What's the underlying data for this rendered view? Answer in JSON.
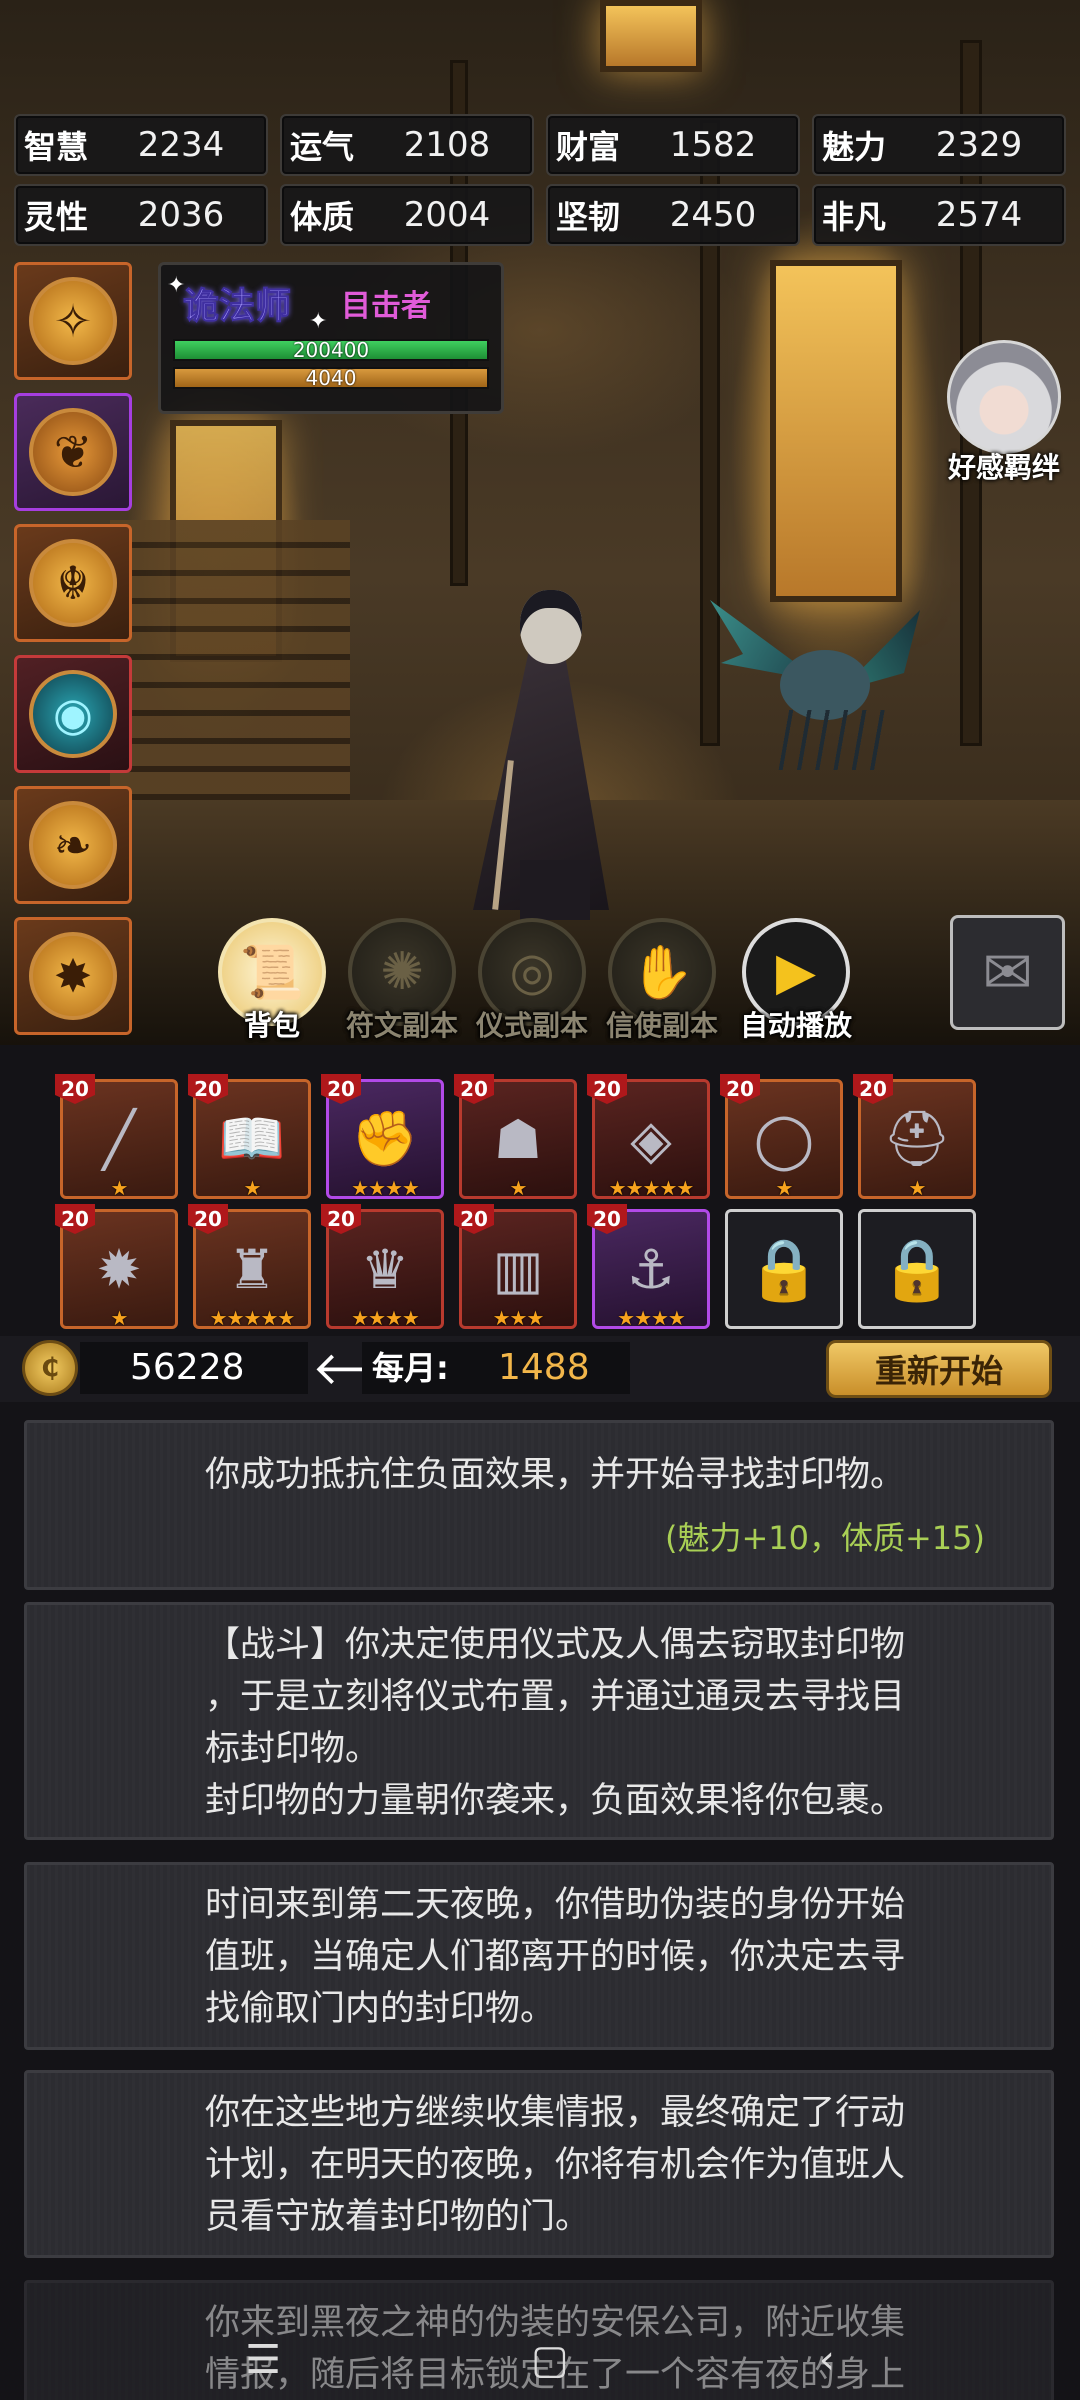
{
  "stats": [
    {
      "label": "智慧",
      "value": "2234"
    },
    {
      "label": "运气",
      "value": "2108"
    },
    {
      "label": "财富",
      "value": "1582"
    },
    {
      "label": "魅力",
      "value": "2329"
    },
    {
      "label": "灵性",
      "value": "2036"
    },
    {
      "label": "体质",
      "value": "2004"
    },
    {
      "label": "坚韧",
      "value": "2450"
    },
    {
      "label": "非凡",
      "value": "2574"
    }
  ],
  "character": {
    "job": "诡法师",
    "title": "目击者",
    "hp_text": "200400",
    "mp_text": "4040",
    "hp_fraction": 1.0,
    "mp_fraction": 1.0
  },
  "skills": [
    {
      "icon": "compass-icon",
      "color": "orange"
    },
    {
      "icon": "tree-icon",
      "color": "purple"
    },
    {
      "icon": "flame-sigil-icon",
      "color": "orange"
    },
    {
      "icon": "eye-orb-icon",
      "color": "red"
    },
    {
      "icon": "leaf-icon",
      "color": "orange"
    },
    {
      "icon": "star-rose-icon",
      "color": "orange"
    }
  ],
  "affinity": {
    "label": "好感羁绊"
  },
  "actions": [
    {
      "label": "背包",
      "icon": "scroll-icon",
      "enabled": true
    },
    {
      "label": "符文副本",
      "icon": "rune-icon",
      "enabled": false
    },
    {
      "label": "仪式副本",
      "icon": "eye-icon",
      "enabled": false
    },
    {
      "label": "信使副本",
      "icon": "hand-icon",
      "enabled": false
    },
    {
      "label": "自动播放",
      "icon": "play-icon",
      "enabled": true
    }
  ],
  "inventory": [
    {
      "level": "20",
      "icon": "staff-icon",
      "rarity": "orange",
      "stars": "★"
    },
    {
      "level": "20",
      "icon": "book-icon",
      "rarity": "orange",
      "stars": "★"
    },
    {
      "level": "20",
      "icon": "gauntlet-icon",
      "rarity": "purple",
      "stars": "★★★★"
    },
    {
      "level": "20",
      "icon": "mask-icon",
      "rarity": "red",
      "stars": "★"
    },
    {
      "level": "20",
      "icon": "rune-plate-icon",
      "rarity": "red",
      "stars": "★★★★★"
    },
    {
      "level": "20",
      "icon": "ring-icon",
      "rarity": "orange",
      "stars": "★"
    },
    {
      "level": "20",
      "icon": "helmet-icon",
      "rarity": "orange",
      "stars": "★"
    },
    {
      "level": "20",
      "icon": "lantern-card-icon",
      "rarity": "orange",
      "stars": "★"
    },
    {
      "level": "20",
      "icon": "golem-icon",
      "rarity": "orange",
      "stars": "★★★★★"
    },
    {
      "level": "20",
      "icon": "crown-icon",
      "rarity": "red",
      "stars": "★★★★"
    },
    {
      "level": "20",
      "icon": "tome-icon",
      "rarity": "red",
      "stars": "★★★"
    },
    {
      "level": "20",
      "icon": "hook-icon",
      "rarity": "purple",
      "stars": "★★★★"
    },
    {
      "level": "",
      "icon": "lock-icon",
      "rarity": "locked",
      "stars": ""
    },
    {
      "level": "",
      "icon": "lock-icon",
      "rarity": "locked",
      "stars": ""
    }
  ],
  "currency": {
    "amount": "56228",
    "monthly_label": "每月:",
    "monthly_value": "1488",
    "restart_label": "重新开始"
  },
  "log": [
    {
      "text": "你成功抵抗住负面效果，并开始寻找封印物。",
      "effect": "(魅力+10，体质+15)"
    },
    {
      "text": "【战斗】你决定使用仪式及人偶去窃取封印物\n，于是立刻将仪式布置，并通过通灵去寻找目\n标封印物。\n封印物的力量朝你袭来，负面效果将你包裹。",
      "effect": ""
    },
    {
      "text": "时间来到第二天夜晚，你借助伪装的身份开始\n值班，当确定人们都离开的时候，你决定去寻\n找偷取门内的封印物。",
      "effect": ""
    },
    {
      "text": "你在这些地方继续收集情报，最终确定了行动\n计划，在明天的夜晚，你将有机会作为值班人\n员看守放着封印物的门。",
      "effect": ""
    },
    {
      "text": "你来到黑夜之神的伪装的安保公司，附近收集\n情报，随后将目标锁定在了一个容有夜的身上",
      "effect": ""
    }
  ],
  "colors": {
    "accent": "#f2b64a",
    "effect_green": "#a9cf55",
    "rarity_orange": "#c7652a",
    "rarity_purple": "#b24ae8",
    "rarity_red": "#b83a2e"
  }
}
